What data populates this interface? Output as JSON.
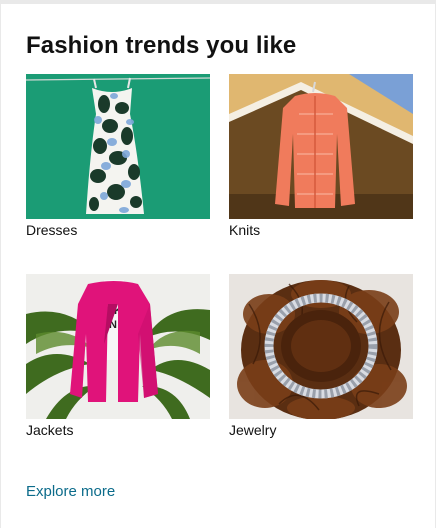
{
  "section": {
    "title": "Fashion trends you like",
    "explore_label": "Explore more"
  },
  "tiles": [
    {
      "label": "Dresses",
      "image_icon": "dress-on-hanger-icon"
    },
    {
      "label": "Knits",
      "image_icon": "knit-cardigan-icon"
    },
    {
      "label": "Jackets",
      "image_icon": "pink-jacket-icon"
    },
    {
      "label": "Jewelry",
      "image_icon": "rhinestone-necklace-icon"
    }
  ],
  "colors": {
    "title": "#111111",
    "link": "#0b6b8a",
    "card_bg": "#ffffff",
    "page_bg": "#e9e9e9"
  }
}
